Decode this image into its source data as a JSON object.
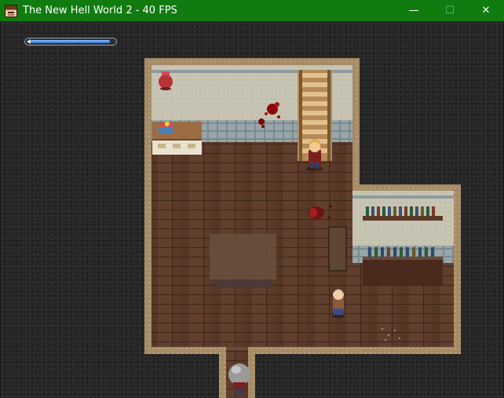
{
  "window": {
    "title": "The New Hell World 2 - 40 FPS",
    "minimize_icon": "minimize-icon",
    "maximize_icon": "maximize-icon",
    "close_icon": "close-icon",
    "minimize_glyph": "—",
    "maximize_glyph": "☐",
    "close_glyph": "✕",
    "titlebar_color": "#107c10"
  },
  "hud": {
    "health_bar_fill": 0.95,
    "bar_color": "#3f86e6"
  },
  "scene": {
    "floor_color": "#5a3a2a",
    "wall_color": "#c9c5b4",
    "trim_color": "#a8906c",
    "void_color": "#262626",
    "objects": [
      "staircase",
      "blood-splatter",
      "player-character",
      "npc-girl",
      "bottle-shelf",
      "bottle-counter",
      "floor-rug",
      "vase",
      "flower-cabinet",
      "door-frame",
      "cursed-statue",
      "blood-trail"
    ]
  }
}
